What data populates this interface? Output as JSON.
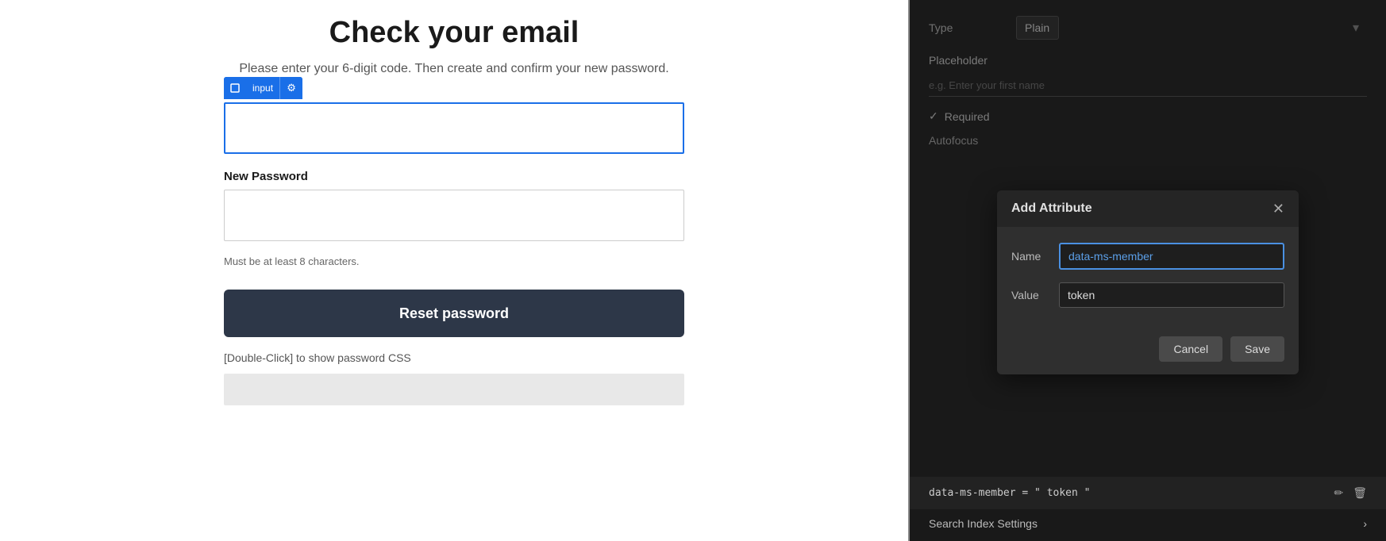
{
  "left": {
    "title": "Check your email",
    "subtitle": "Please enter your 6-digit code. Then create and\nconfirm your new password.",
    "input_toolbar": {
      "icon_label": "input",
      "gear_label": "⚙"
    },
    "code_input_placeholder": "",
    "new_password_label": "New Password",
    "new_password_placeholder": "",
    "hint": "Must be at least 8 characters.",
    "reset_button_label": "Reset password",
    "double_click_hint": "[Double-Click] to show password CSS"
  },
  "right": {
    "type_label": "Type",
    "type_value": "Plain",
    "placeholder_label": "Placeholder",
    "placeholder_input_value": "e.g. Enter your first name",
    "required_label": "Required",
    "autofocus_label": "Autofocus",
    "attribute_display": "data-ms-member = \" token \""
  },
  "modal": {
    "title": "Add Attribute",
    "close_icon": "✕",
    "name_label": "Name",
    "name_value": "data-ms-member",
    "value_label": "Value",
    "value_value": "token",
    "cancel_label": "Cancel",
    "save_label": "Save"
  },
  "bottom": {
    "settings_label": "Search Index Settings",
    "edit_icon": "✏",
    "delete_icon": "🗑"
  }
}
